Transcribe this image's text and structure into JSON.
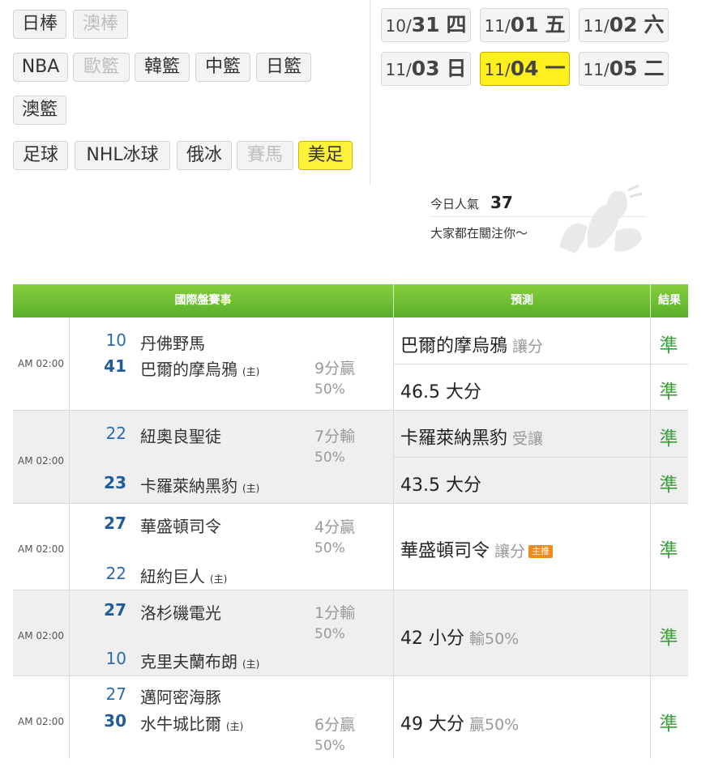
{
  "sports": {
    "row1": [
      {
        "label": "日棒",
        "state": "normal"
      },
      {
        "label": "澳棒",
        "state": "disabled"
      }
    ],
    "row2": [
      {
        "label": "NBA",
        "state": "normal"
      },
      {
        "label": "歐籃",
        "state": "disabled"
      },
      {
        "label": "韓籃",
        "state": "normal"
      },
      {
        "label": "中籃",
        "state": "normal"
      },
      {
        "label": "日籃",
        "state": "normal"
      }
    ],
    "row3": [
      {
        "label": "澳籃",
        "state": "normal"
      }
    ],
    "row4": [
      {
        "label": "足球",
        "state": "normal"
      },
      {
        "label": "NHL冰球",
        "state": "normal"
      },
      {
        "label": "俄冰",
        "state": "normal"
      },
      {
        "label": "賽馬",
        "state": "disabled"
      },
      {
        "label": "美足",
        "state": "active"
      }
    ]
  },
  "dates": [
    {
      "month": "10/",
      "day": "31",
      "weekday": "四",
      "active": false
    },
    {
      "month": "11/",
      "day": "01",
      "weekday": "五",
      "active": false
    },
    {
      "month": "11/",
      "day": "02",
      "weekday": "六",
      "active": false
    },
    {
      "month": "11/",
      "day": "03",
      "weekday": "日",
      "active": false
    },
    {
      "month": "11/",
      "day": "04",
      "weekday": "一",
      "active": true
    },
    {
      "month": "11/",
      "day": "05",
      "weekday": "二",
      "active": false
    }
  ],
  "popularity": {
    "label": "今日人氣",
    "count": "37",
    "message": "大家都在關注你～"
  },
  "table": {
    "headers": {
      "matches": "國際盤賽事",
      "prediction": "預測",
      "result": "結果"
    },
    "home_mark": "(主)",
    "games": [
      {
        "time": "AM 02:00",
        "away_score": "10",
        "away_team": "丹佛野馬",
        "home_score": "41",
        "home_team": "巴爾的摩烏鴉",
        "spread_result": "9分贏",
        "spread_pct": "50%",
        "predictions": [
          {
            "text": "巴爾的摩烏鴉",
            "note": "讓分",
            "result": "準"
          },
          {
            "text": "46.5 大分",
            "note": "",
            "result": "準"
          }
        ]
      },
      {
        "time": "AM 02:00",
        "away_score": "22",
        "away_team": "紐奧良聖徒",
        "home_score": "23",
        "home_team": "卡羅萊納黑豹",
        "spread_result": "7分輸",
        "spread_pct": "50%",
        "predictions": [
          {
            "text": "卡羅萊納黑豹",
            "note": "受讓",
            "result": "準"
          },
          {
            "text": "43.5 大分",
            "note": "",
            "result": "準"
          }
        ]
      },
      {
        "time": "AM 02:00",
        "away_score": "27",
        "away_team": "華盛頓司令",
        "home_score": "22",
        "home_team": "紐約巨人",
        "spread_result": "4分贏",
        "spread_pct": "50%",
        "predictions": [
          {
            "text": "華盛頓司令",
            "note": "讓分",
            "tag": "主推",
            "result": "準"
          }
        ]
      },
      {
        "time": "AM 02:00",
        "away_score": "27",
        "away_team": "洛杉磯電光",
        "home_score": "10",
        "home_team": "克里夫蘭布朗",
        "spread_result": "1分輸",
        "spread_pct": "50%",
        "predictions": [
          {
            "text": "42 小分",
            "note": "輸50%",
            "result": "準"
          }
        ]
      },
      {
        "time": "AM 02:00",
        "away_score": "27",
        "away_team": "邁阿密海豚",
        "home_score": "30",
        "home_team": "水牛城比爾",
        "spread_result": "6分贏",
        "spread_pct": "50%",
        "predictions": [
          {
            "text": "49 大分",
            "note": "贏50%",
            "result": "準"
          }
        ]
      }
    ]
  }
}
